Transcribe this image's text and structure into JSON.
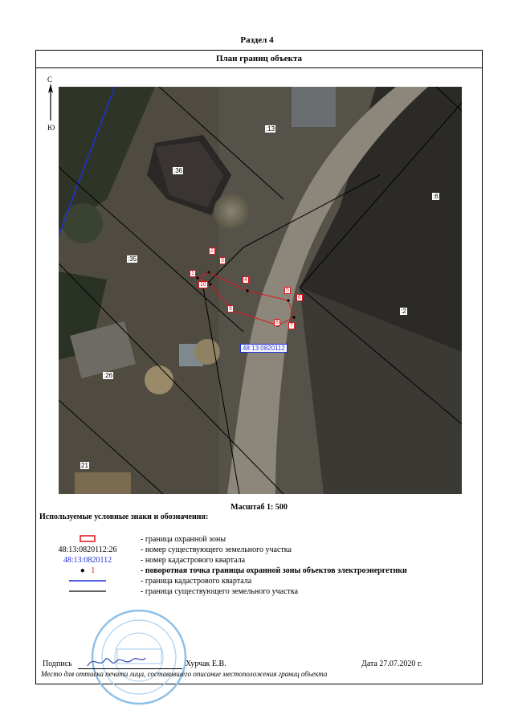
{
  "section": "Раздел 4",
  "plan_title": "План границ объекта",
  "compass": {
    "north": "С",
    "south": "Ю"
  },
  "map": {
    "parcel_labels": [
      ":13",
      ":36",
      ":6",
      ":35",
      ":2",
      ":26",
      "21"
    ],
    "point_labels": [
      "1",
      "2",
      "3",
      "4",
      "5",
      "6",
      "7",
      "8",
      "9",
      "10"
    ],
    "quarter_label": "48:13:0820112"
  },
  "scale": "Масштаб 1: 500",
  "legend": {
    "title": "Используемые условные знаки и обозначения:",
    "items": [
      {
        "symbol": "",
        "text": "- граница  охранной зоны"
      },
      {
        "symbol": "48:13:0820112:26",
        "text": "- номер существующего земельного участка"
      },
      {
        "symbol": "48:13:0820112",
        "text": "- номер кадастрового квартала"
      },
      {
        "symbol": "1",
        "text": "- поворотная точка границы охранной зоны объектов электроэнергетики"
      },
      {
        "symbol": "",
        "text": "- граница кадастрового квартала"
      },
      {
        "symbol": "",
        "text": "- граница существующего земельного участка"
      }
    ]
  },
  "signature": {
    "label": "Подпись",
    "name": "Хурчак Е.В.",
    "date": "Дата 27.07.2020 г.",
    "note": "Место для оттиска печати лица, составившего описание местоположения границ объекта"
  },
  "colors": {
    "zone": "#e0141a",
    "quarter": "#1f2fd6",
    "parcel": "#000000"
  }
}
